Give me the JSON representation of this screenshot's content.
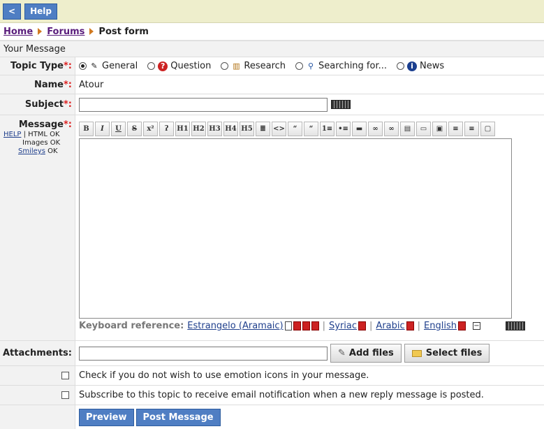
{
  "topbar": {
    "back_label": "<",
    "help_label": "Help"
  },
  "breadcrumb": {
    "home": "Home",
    "forums": "Forums",
    "current": "Post form"
  },
  "section_title": "Your Message",
  "topic_type": {
    "label": "Topic Type",
    "required": "*:",
    "options": [
      "General",
      "Question",
      "Research",
      "Searching for...",
      "News"
    ],
    "selected": "General"
  },
  "name": {
    "label": "Name",
    "required": "*:",
    "value": "Atour"
  },
  "subject": {
    "label": "Subject",
    "required": "*:",
    "value": ""
  },
  "message": {
    "label": "Message",
    "required": "*:",
    "help_link": "HELP",
    "html_ok": " | HTML OK",
    "images_ok": "Images OK",
    "smileys_link": "Smileys",
    "smileys_ok": " OK",
    "toolbar": [
      "B",
      "I",
      "U",
      "S",
      "x²",
      "ʔ",
      "H1",
      "H2",
      "H3",
      "H4",
      "H5",
      "≣",
      "<>",
      "“",
      "“",
      "1≡",
      "•≡",
      "▬",
      "∞",
      "∞",
      "▤",
      "▭",
      "▣",
      "≡",
      "≡",
      "▢"
    ],
    "value": ""
  },
  "keyboard_reference": {
    "label": "Keyboard reference:",
    "estrangelo": "Estrangelo (Aramaic)",
    "syriac": "Syriac",
    "arabic": "Arabic",
    "english": "English",
    "separator": "|",
    "toggle": "−"
  },
  "attachments": {
    "label": "Attachments:",
    "add_files": "Add files",
    "select_files": "Select files"
  },
  "no_emotion_icons": "Check if you do not wish to use emotion icons in your message.",
  "subscribe": "Subscribe to this topic to receive email notification when a new reply message is posted.",
  "buttons": {
    "preview": "Preview",
    "post": "Post Message"
  },
  "colors": {
    "topbar": "#eeeecc",
    "button_blue": "#4f7ec3",
    "breadcrumb_link": "#5a1e7c",
    "required": "#dd2222"
  }
}
